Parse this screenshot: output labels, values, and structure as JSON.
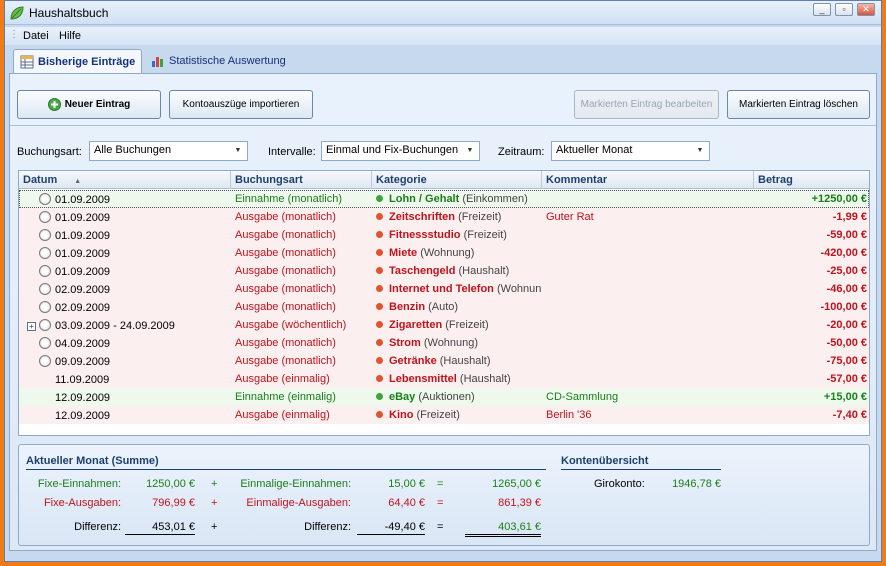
{
  "window": {
    "title": "Haushaltsbuch",
    "min_glyph": "_",
    "max_glyph": "▫",
    "close_glyph": "✕"
  },
  "menu": [
    {
      "label": "Datei"
    },
    {
      "label": "Hilfe"
    }
  ],
  "tabs": [
    {
      "label": "Bisherige Einträge",
      "active": true
    },
    {
      "label": "Statistische Auswertung",
      "active": false
    }
  ],
  "toolbar": {
    "new_entry": "Neuer Eintrag",
    "import": "Kontoauszüge importieren",
    "edit": "Markierten Eintrag bearbeiten",
    "delete": "Markierten Eintrag löschen"
  },
  "filters": {
    "buchungsart_label": "Buchungsart:",
    "buchungsart_value": "Alle Buchungen",
    "intervalle_label": "Intervalle:",
    "intervalle_value": "Einmal und Fix-Buchungen",
    "zeitraum_label": "Zeitraum:",
    "zeitraum_value": "Aktueller Monat"
  },
  "grid": {
    "columns": [
      "Datum",
      "Buchungsart",
      "Kategorie",
      "Kommentar",
      "Betrag"
    ],
    "sort_indicator": "▲",
    "rows": [
      {
        "kind": "inc",
        "date": "01.09.2009",
        "type": "Einnahme (monatlich)",
        "cat": "Lohn / Gehalt",
        "sub": "(Einkommen)",
        "comment": "",
        "amount": "+1250,00 €",
        "recurring": true,
        "selected": true
      },
      {
        "kind": "exp",
        "date": "01.09.2009",
        "type": "Ausgabe (monatlich)",
        "cat": "Zeitschriften",
        "sub": "(Freizeit)",
        "comment": "Guter Rat",
        "amount": "-1,99 €",
        "recurring": true
      },
      {
        "kind": "exp",
        "date": "01.09.2009",
        "type": "Ausgabe (monatlich)",
        "cat": "Fitnessstudio",
        "sub": "(Freizeit)",
        "comment": "",
        "amount": "-59,00 €",
        "recurring": true
      },
      {
        "kind": "exp",
        "date": "01.09.2009",
        "type": "Ausgabe (monatlich)",
        "cat": "Miete",
        "sub": "(Wohnung)",
        "comment": "",
        "amount": "-420,00 €",
        "recurring": true
      },
      {
        "kind": "exp",
        "date": "01.09.2009",
        "type": "Ausgabe (monatlich)",
        "cat": "Taschengeld",
        "sub": "(Haushalt)",
        "comment": "",
        "amount": "-25,00 €",
        "recurring": true
      },
      {
        "kind": "exp",
        "date": "02.09.2009",
        "type": "Ausgabe (monatlich)",
        "cat": "Internet und Telefon",
        "sub": "(Wohnun",
        "comment": "",
        "amount": "-46,00 €",
        "recurring": true
      },
      {
        "kind": "exp",
        "date": "02.09.2009",
        "type": "Ausgabe (monatlich)",
        "cat": "Benzin",
        "sub": "(Auto)",
        "comment": "",
        "amount": "-100,00 €",
        "recurring": true
      },
      {
        "kind": "exp",
        "date": "03.09.2009 -  24.09.2009",
        "type": "Ausgabe (wöchentlich)",
        "cat": "Zigaretten",
        "sub": "(Freizeit)",
        "comment": "",
        "amount": "-20,00 €",
        "recurring": true,
        "expandable": true
      },
      {
        "kind": "exp",
        "date": "04.09.2009",
        "type": "Ausgabe (monatlich)",
        "cat": "Strom",
        "sub": "(Wohnung)",
        "comment": "",
        "amount": "-50,00 €",
        "recurring": true
      },
      {
        "kind": "exp",
        "date": "09.09.2009",
        "type": "Ausgabe (monatlich)",
        "cat": "Getränke",
        "sub": "(Haushalt)",
        "comment": "",
        "amount": "-75,00 €",
        "recurring": true
      },
      {
        "kind": "exp",
        "date": "11.09.2009",
        "type": "Ausgabe (einmalig)",
        "cat": "Lebensmittel",
        "sub": "(Haushalt)",
        "comment": "",
        "amount": "-57,00 €",
        "recurring": false
      },
      {
        "kind": "inc",
        "date": "12.09.2009",
        "type": "Einnahme (einmalig)",
        "cat": "eBay",
        "sub": "(Auktionen)",
        "comment": "CD-Sammlung",
        "amount": "+15,00 €",
        "recurring": false
      },
      {
        "kind": "exp",
        "date": "12.09.2009",
        "type": "Ausgabe (einmalig)",
        "cat": "Kino",
        "sub": "(Freizeit)",
        "comment": "Berlin '36",
        "amount": "-7,40 €",
        "recurring": false
      }
    ]
  },
  "summary": {
    "title": "Aktueller Monat (Summe)",
    "fixe_einnahmen_label": "Fixe-Einnahmen:",
    "fixe_einnahmen": "1250,00 €",
    "fixe_ausgaben_label": "Fixe-Ausgaben:",
    "fixe_ausgaben": "796,99 €",
    "differenz_label": "Differenz:",
    "fixe_differenz": "453,01 €",
    "einmal_einnahmen_label": "Einmalige-Einnahmen:",
    "einmal_einnahmen": "15,00 €",
    "einmal_ausgaben_label": "Einmalige-Ausgaben:",
    "einmal_ausgaben": "64,40 €",
    "einmal_differenz": "-49,40 €",
    "total_einnahmen": "1265,00 €",
    "total_ausgaben": "861,39 €",
    "total_differenz": "403,61 €",
    "plus": "+",
    "equals": "=",
    "konto_title": "Kontenübersicht",
    "girokonto_label": "Girokonto:",
    "girokonto_value": "1946,78 €"
  },
  "colors": {
    "income": "#1a7f1a",
    "expense": "#c0141c",
    "accent": "#1e3f6e"
  }
}
